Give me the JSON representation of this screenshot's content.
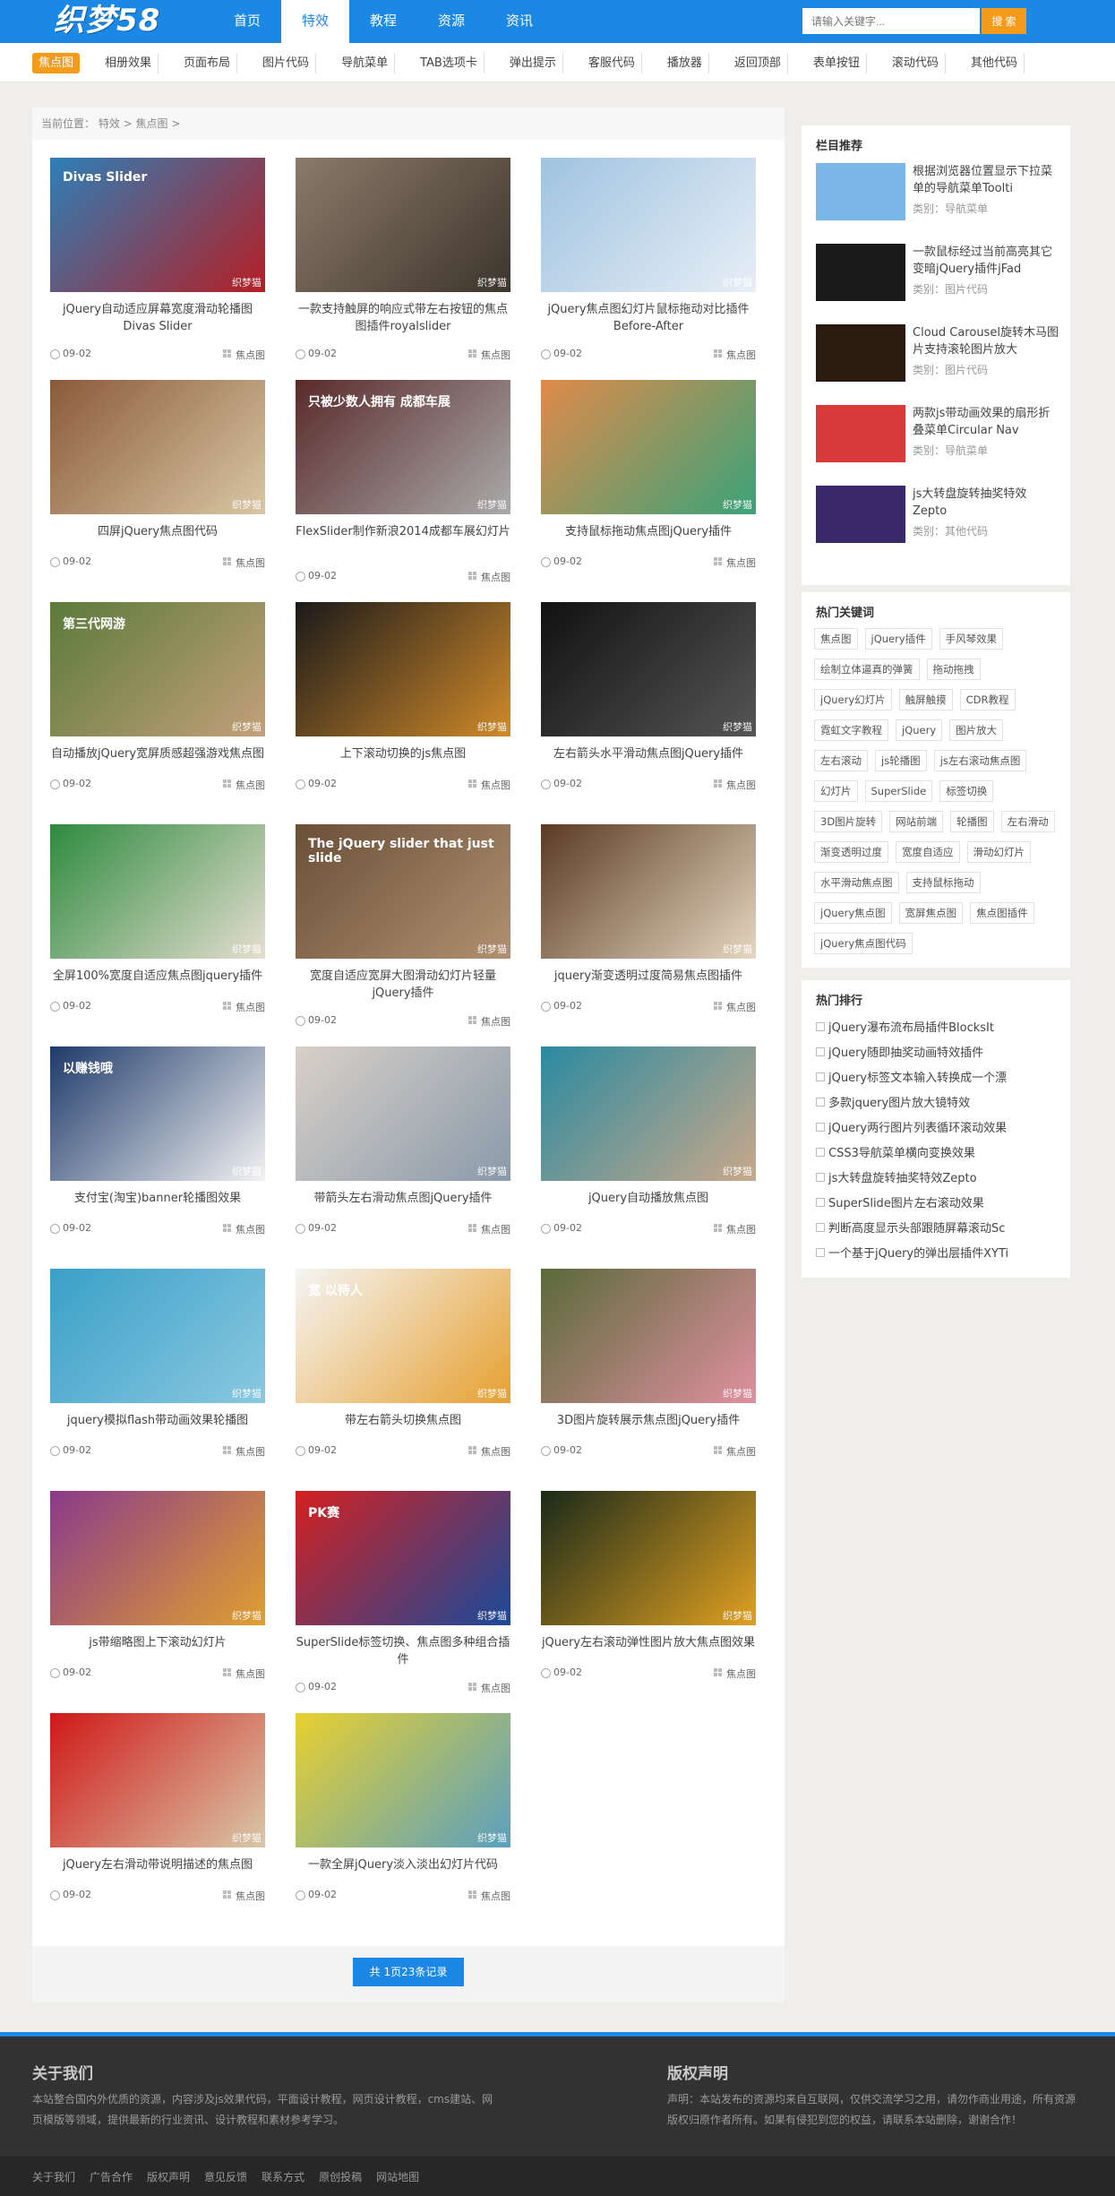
{
  "header": {
    "logo": "织梦58",
    "nav": [
      "首页",
      "特效",
      "教程",
      "资源",
      "资讯"
    ],
    "nav_active": 1,
    "search_placeholder": "请输入关键字...",
    "search_button": "搜 索"
  },
  "subnav": [
    "焦点图",
    "相册效果",
    "页面布局",
    "图片代码",
    "导航菜单",
    "TAB选项卡",
    "弹出提示",
    "客服代码",
    "播放器",
    "返回顶部",
    "表单按钮",
    "滚动代码",
    "其他代码"
  ],
  "breadcrumb": "当前位置： 特效 > 焦点图 >",
  "cards": [
    {
      "title": "jQuery自动适应屏幕宽度滑动轮播图Divas Slider",
      "date": "09-02",
      "cat": "焦点图",
      "overlay": "Divas Slider",
      "color1": "#2d7fb8",
      "color2": "#b41f24"
    },
    {
      "title": "一款支持触屏的响应式带左右按钮的焦点图插件royalslider",
      "date": "09-02",
      "cat": "焦点图",
      "overlay": "",
      "color1": "#8b7a6a",
      "color2": "#3e352d"
    },
    {
      "title": "jQuery焦点图幻灯片鼠标拖动对比插件Before-After",
      "date": "09-02",
      "cat": "焦点图",
      "overlay": "",
      "color1": "#9fc3e0",
      "color2": "#e7eef6"
    },
    {
      "title": "四屏jQuery焦点图代码",
      "date": "09-02",
      "cat": "焦点图",
      "overlay": "",
      "color1": "#8a5a3a",
      "color2": "#d9c7a5"
    },
    {
      "title": "FlexSlider制作新浪2014成都车展幻灯片",
      "date": "09-02",
      "cat": "焦点图",
      "overlay": "只被少数人拥有 成都车展",
      "color1": "#5a2a2a",
      "color2": "#aaaaaa"
    },
    {
      "title": "支持鼠标拖动焦点图jQuery插件",
      "date": "09-02",
      "cat": "焦点图",
      "overlay": "",
      "color1": "#e08a4a",
      "color2": "#3aa37a"
    },
    {
      "title": "自动播放jQuery宽屏质感超强游戏焦点图",
      "date": "09-02",
      "cat": "焦点图",
      "overlay": "第三代网游",
      "color1": "#5a7a3a",
      "color2": "#c4a07a"
    },
    {
      "title": "上下滚动切换的js焦点图",
      "date": "09-02",
      "cat": "焦点图",
      "overlay": "",
      "color1": "#1a1a1a",
      "color2": "#d08a2a"
    },
    {
      "title": "左右箭头水平滑动焦点图jQuery插件",
      "date": "09-02",
      "cat": "焦点图",
      "overlay": "",
      "color1": "#111111",
      "color2": "#555555"
    },
    {
      "title": "全屏100%宽度自适应焦点图jquery插件",
      "date": "09-02",
      "cat": "焦点图",
      "overlay": "",
      "color1": "#2d8a3e",
      "color2": "#e6ded0"
    },
    {
      "title": "宽度自适应宽屏大图滑动幻灯片轻量jQuery插件",
      "date": "09-02",
      "cat": "焦点图",
      "overlay": "The jQuery slider that just slide",
      "color1": "#6a5038",
      "color2": "#b09070"
    },
    {
      "title": "jquery渐变透明过度简易焦点图插件",
      "date": "09-02",
      "cat": "焦点图",
      "overlay": "",
      "color1": "#5a3a24",
      "color2": "#e6d7c0"
    },
    {
      "title": "支付宝(淘宝)banner轮播图效果",
      "date": "09-02",
      "cat": "焦点图",
      "overlay": "以赚钱哦",
      "color1": "#1e3a6a",
      "color2": "#f2f2f2"
    },
    {
      "title": "带箭头左右滑动焦点图jQuery插件",
      "date": "09-02",
      "cat": "焦点图",
      "overlay": "",
      "color1": "#d8d0c8",
      "color2": "#8a9aaa"
    },
    {
      "title": "jQuery自动播放焦点图",
      "date": "09-02",
      "cat": "焦点图",
      "overlay": "",
      "color1": "#2a8aa0",
      "color2": "#c9a88a"
    },
    {
      "title": "jquery模拟flash带动画效果轮播图",
      "date": "09-02",
      "cat": "焦点图",
      "overlay": "",
      "color1": "#3aa0c8",
      "color2": "#8ac8e0"
    },
    {
      "title": "带左右箭头切换焦点图",
      "date": "09-02",
      "cat": "焦点图",
      "overlay": "宽 以待人",
      "color1": "#f5f5f5",
      "color2": "#e6a030"
    },
    {
      "title": "3D图片旋转展示焦点图jQuery插件",
      "date": "09-02",
      "cat": "焦点图",
      "overlay": "",
      "color1": "#5a6a3a",
      "color2": "#e090a0"
    },
    {
      "title": "js带缩略图上下滚动幻灯片",
      "date": "09-02",
      "cat": "焦点图",
      "overlay": "",
      "color1": "#8a3a8a",
      "color2": "#e0a030"
    },
    {
      "title": "SuperSlide标签切换、焦点图多种组合插件",
      "date": "09-02",
      "cat": "焦点图",
      "overlay": "PK赛",
      "color1": "#d32020",
      "color2": "#1a4a9a"
    },
    {
      "title": "jQuery左右滚动弹性图片放大焦点图效果",
      "date": "09-02",
      "cat": "焦点图",
      "overlay": "",
      "color1": "#1a2a1a",
      "color2": "#e0a020"
    },
    {
      "title": "jQuery左右滑动带说明描述的焦点图",
      "date": "09-02",
      "cat": "焦点图",
      "overlay": "",
      "color1": "#d01818",
      "color2": "#d8c8a8"
    },
    {
      "title": "一款全屏jQuery淡入淡出幻灯片代码",
      "date": "09-02",
      "cat": "焦点图",
      "overlay": "",
      "color1": "#e8d030",
      "color2": "#5aa0c0"
    }
  ],
  "watermark": "织梦猫",
  "pager": "共 1页23条记录",
  "sidebar": {
    "rec_title": "栏目推荐",
    "rec": [
      {
        "title": "根据浏览器位置显示下拉菜单的导航菜单Toolti",
        "cat": "类别：导航菜单",
        "color": "#7ab6e8"
      },
      {
        "title": "一款鼠标经过当前高亮其它变暗jQuery插件jFad",
        "cat": "类别：图片代码",
        "color": "#1a1a1a"
      },
      {
        "title": "Cloud Carousel旋转木马图片支持滚轮图片放大",
        "cat": "类别：图片代码",
        "color": "#2a1a10"
      },
      {
        "title": "两款js带动画效果的扇形折叠菜单Circular Nav",
        "cat": "类别：导航菜单",
        "color": "#d83a3a"
      },
      {
        "title": "js大转盘旋转抽奖特效Zepto",
        "cat": "类别：其他代码",
        "color": "#3a2a6a"
      }
    ],
    "kw_title": "热门关键词",
    "keywords": [
      "焦点图",
      "jQuery插件",
      "手风琴效果",
      "绘制立体逼真的弹簧",
      "拖动拖拽",
      "jQuery幻灯片",
      "触屏触摸",
      "CDR教程",
      "霓虹文字教程",
      "jQuery",
      "图片放大",
      "左右滚动",
      "js轮播图",
      "js左右滚动焦点图",
      "幻灯片",
      "SuperSlide",
      "标签切换",
      "3D图片旋转",
      "网站前端",
      "轮播图",
      "左右滑动",
      "渐变透明过度",
      "宽度自适应",
      "滑动幻灯片",
      "水平滑动焦点图",
      "支持鼠标拖动",
      "jQuery焦点图",
      "宽屏焦点图",
      "焦点图插件",
      "jQuery焦点图代码"
    ],
    "hot_title": "热门排行",
    "hot": [
      "jQuery瀑布流布局插件BlocksIt",
      "jQuery随即抽奖动画特效插件",
      "jQuery标签文本输入转换成一个漂",
      "多款jquery图片放大镜特效",
      "jQuery两行图片列表循环滚动效果",
      "CSS3导航菜单横向变换效果",
      "js大转盘旋转抽奖特效Zepto",
      "SuperSlide图片左右滚动效果",
      "判断高度显示头部跟随屏幕滚动Sc",
      "一个基于jQuery的弹出层插件XYTi"
    ]
  },
  "footer": {
    "about_title": "关于我们",
    "about_text": "本站整合国内外优质的资源，内容涉及js效果代码，平面设计教程，网页设计教程，cms建站、网页模版等领域，提供最新的行业资讯、设计教程和素材参考学习。",
    "copy_title": "版权声明",
    "copy_text": "声明：本站发布的资源均来自互联网，仅供交流学习之用，请勿作商业用途，所有资源版权归原作者所有。如果有侵犯到您的权益，请联系本站删除，谢谢合作！",
    "links": [
      "关于我们",
      "广告合作",
      "版权声明",
      "意见反馈",
      "联系方式",
      "原创投稿",
      "网站地图"
    ]
  }
}
